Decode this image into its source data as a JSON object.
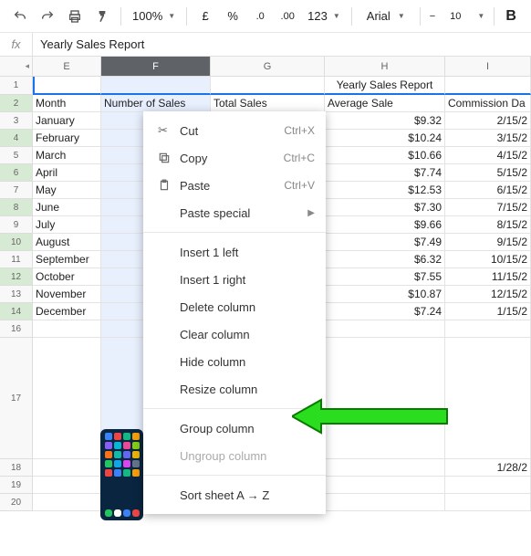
{
  "toolbar": {
    "zoom": "100%",
    "pound": "£",
    "percent": "%",
    "dec0": ".0",
    "dec00": ".00",
    "fmt123": "123",
    "font": "Arial",
    "size": "10",
    "bold": "B"
  },
  "fx": {
    "label": "fx",
    "value": "Yearly Sales Report"
  },
  "cols": {
    "E": "E",
    "F": "F",
    "G": "G",
    "H": "H",
    "I": "I"
  },
  "rows": [
    "1",
    "2",
    "3",
    "4",
    "5",
    "6",
    "7",
    "8",
    "9",
    "10",
    "11",
    "12",
    "13",
    "14",
    "16",
    "17",
    "18",
    "19",
    "20"
  ],
  "title": "Yearly Sales Report",
  "headers": {
    "month": "Month",
    "numSales": "Number of Sales",
    "totalSales": "Total Sales",
    "avgSale": "Average Sale",
    "commDate": "Commission Da"
  },
  "data": [
    {
      "m": "January",
      "avg": "$9.32",
      "d": "2/15/2"
    },
    {
      "m": "February",
      "avg": "$10.24",
      "d": "3/15/2"
    },
    {
      "m": "March",
      "avg": "$10.66",
      "d": "4/15/2"
    },
    {
      "m": "April",
      "avg": "$7.74",
      "d": "5/15/2"
    },
    {
      "m": "May",
      "avg": "$12.53",
      "d": "6/15/2"
    },
    {
      "m": "June",
      "avg": "$7.30",
      "d": "7/15/2"
    },
    {
      "m": "July",
      "avg": "$9.66",
      "d": "8/15/2"
    },
    {
      "m": "August",
      "avg": "$7.49",
      "d": "9/15/2"
    },
    {
      "m": "September",
      "avg": "$6.32",
      "d": "10/15/2"
    },
    {
      "m": "October",
      "avg": "$7.55",
      "d": "11/15/2"
    },
    {
      "m": "November",
      "avg": "$10.87",
      "d": "12/15/2"
    },
    {
      "m": "December",
      "avg": "$7.24",
      "d": "1/15/2"
    }
  ],
  "extraDate": "1/28/2",
  "menu": {
    "cut": "Cut",
    "cutK": "Ctrl+X",
    "copy": "Copy",
    "copyK": "Ctrl+C",
    "paste": "Paste",
    "pasteK": "Ctrl+V",
    "pasteSpecial": "Paste special",
    "insLeft": "Insert 1 left",
    "insRight": "Insert 1 right",
    "delCol": "Delete column",
    "clearCol": "Clear column",
    "hideCol": "Hide column",
    "resizeCol": "Resize column",
    "groupCol": "Group column",
    "ungroupCol": "Ungroup column",
    "sortAZ": "Sort sheet A → Z"
  }
}
